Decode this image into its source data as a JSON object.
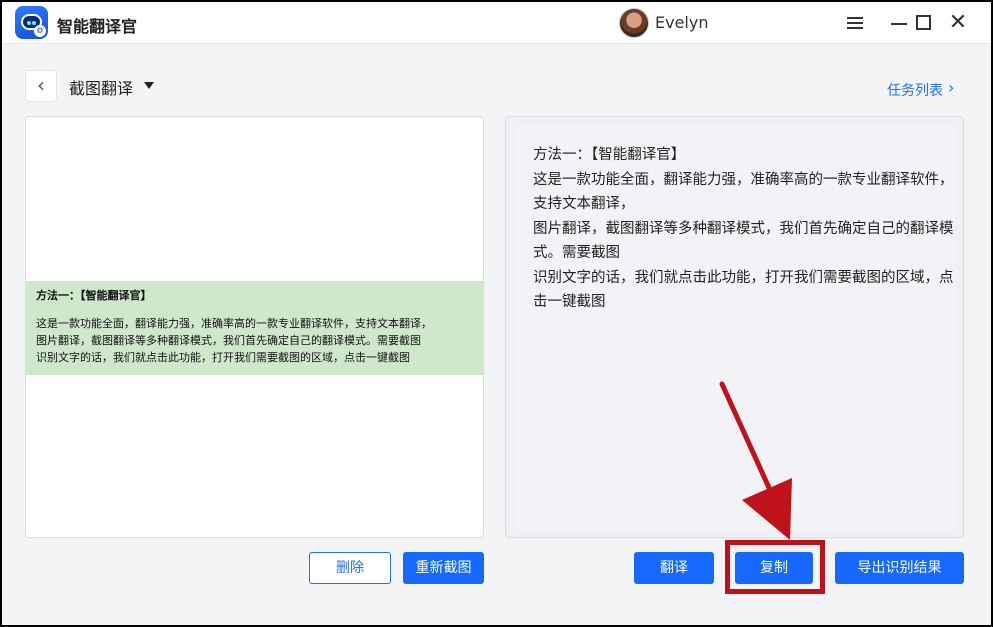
{
  "app": {
    "title": "智能翻译官",
    "user": "Evelyn"
  },
  "toolbar": {
    "mode": "截图翻译",
    "task_list": "任务列表"
  },
  "screenshot": {
    "title": "方法一：【智能翻译官】",
    "lines": [
      "这是一款功能全面，翻译能力强，准确率高的一款专业翻译软件，支持文本翻译，",
      "图片翻译，截图翻译等多种翻译模式，我们首先确定自己的翻译模式。需要截图",
      "识别文字的话，我们就点击此功能，打开我们需要截图的区域，点击一键截图"
    ]
  },
  "result": {
    "lines": [
      "方法一：【智能翻译官】",
      "这是一款功能全面，翻译能力强，准确率高的一款专业翻译软件，支持文本翻译，",
      "图片翻译，截图翻译等多种翻译模式，我们首先确定自己的翻译模式。需要截图",
      "识别文字的话，我们就点击此功能，打开我们需要截图的区域，点击一键截图"
    ]
  },
  "buttons": {
    "delete": "删除",
    "recapture": "重新截图",
    "translate": "翻译",
    "copy": "复制",
    "export": "导出识别结果"
  },
  "colors": {
    "primary": "#1668ff",
    "highlight": "#c0121a",
    "screenshot_bg": "#cfe8cc"
  }
}
